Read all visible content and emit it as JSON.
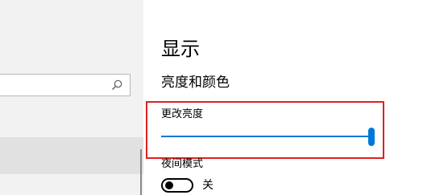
{
  "sidebar": {
    "search": {
      "placeholder": "",
      "icon": "search-icon"
    },
    "selected_item_label": ""
  },
  "main": {
    "page_title": "显示",
    "brightness_section": {
      "title": "亮度和颜色",
      "change_brightness_label": "更改亮度",
      "brightness_value_percent": 100
    },
    "night_light": {
      "label": "夜间模式",
      "state_label": "关",
      "is_on": false
    }
  },
  "colors": {
    "accent": "#0078d7",
    "highlight_border": "#e02020",
    "sidebar_background": "#f2f2f2"
  }
}
